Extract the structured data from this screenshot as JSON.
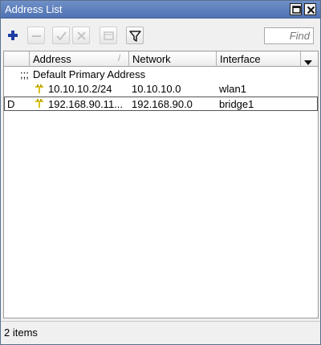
{
  "window": {
    "title": "Address List",
    "icons": {
      "maximize": "maximize-icon",
      "close": "close-icon"
    }
  },
  "toolbar": {
    "buttons": [
      {
        "icon": "plus-icon",
        "enabled": true
      },
      {
        "icon": "minus-icon",
        "enabled": false
      },
      {
        "icon": "check-icon",
        "enabled": false
      },
      {
        "icon": "cross-icon",
        "enabled": false
      },
      {
        "icon": "comment-icon",
        "enabled": false
      },
      {
        "icon": "filter-icon",
        "enabled": true
      }
    ],
    "find_placeholder": "Find",
    "colors": {
      "plus": "#1e3ea3",
      "disabled": "#bdbdbd",
      "filter": "#1c1c1c"
    }
  },
  "table": {
    "columns": [
      "Address",
      "Network",
      "Interface"
    ],
    "comment_prefix": ";;;",
    "comment_text": "Default Primary Address",
    "rows": [
      {
        "flag": "",
        "address": "10.10.10.2/24",
        "network": "10.10.10.0",
        "interface": "wlan1"
      },
      {
        "flag": "D",
        "address": "192.168.90.11...",
        "network": "192.168.90.0",
        "interface": "bridge1"
      }
    ],
    "address_icon": "address-plug-icon",
    "address_icon_color": "#d8c21a"
  },
  "status": {
    "count_text": "2 items"
  }
}
